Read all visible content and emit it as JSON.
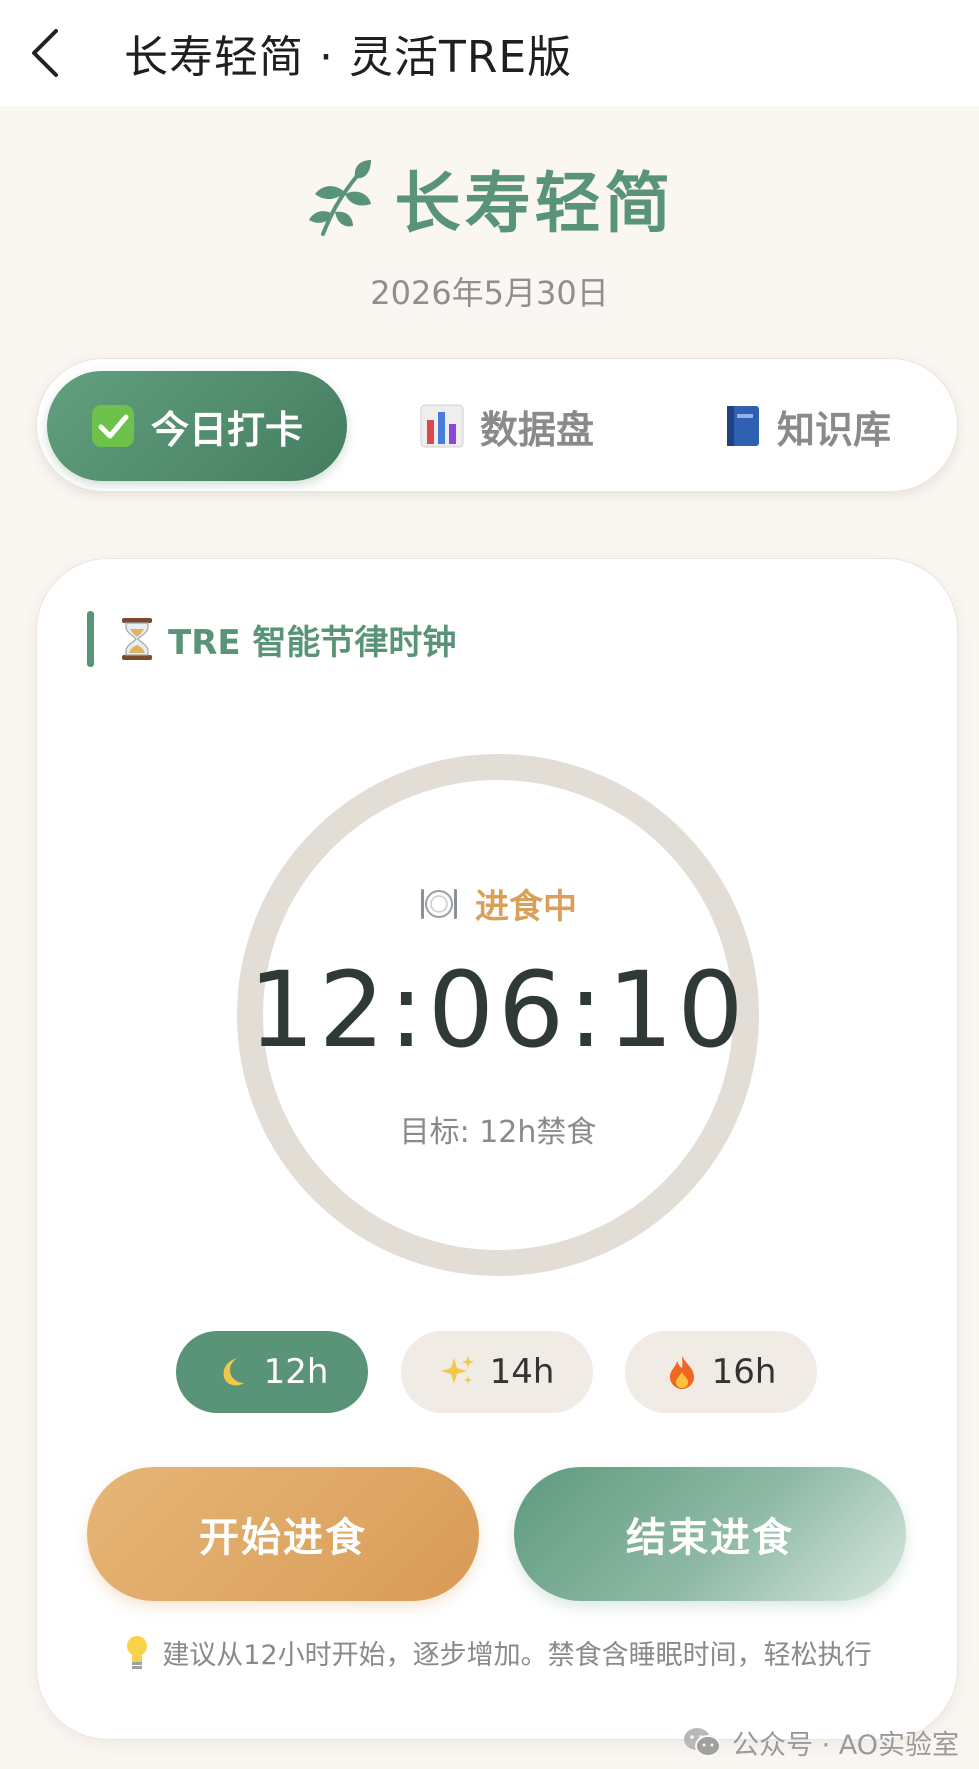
{
  "navbar": {
    "back_icon": "chevron-left-icon",
    "title": "长寿轻简 · 灵活TRE版"
  },
  "brand": {
    "icon": "leaf-sprig-icon",
    "title": "长寿轻简",
    "date": "2026年5月30日",
    "accent_color": "#5a9478"
  },
  "tabs": [
    {
      "label": "今日打卡",
      "icon": "checkmark-box-icon",
      "active": true
    },
    {
      "label": "数据盘",
      "icon": "bar-chart-icon",
      "active": false
    },
    {
      "label": "知识库",
      "icon": "book-icon",
      "active": false
    }
  ],
  "tracker": {
    "section_title": "TRE 智能节律时钟",
    "section_icon": "hourglass-icon",
    "status_icon": "plate-fork-knife-icon",
    "status": "进食中",
    "status_color": "#d9a05b",
    "timer": "12:06:10",
    "goal": "目标: 12h禁食",
    "durations": [
      {
        "label": "12h",
        "icon": "crescent-moon-icon",
        "active": true
      },
      {
        "label": "14h",
        "icon": "sparkles-icon",
        "active": false
      },
      {
        "label": "16h",
        "icon": "fire-icon",
        "active": false
      }
    ],
    "start_button": "开始进食",
    "end_button": "结束进食",
    "tip_icon": "light-bulb-icon",
    "tip": "建议从12小时开始，逐步增加。禁食含睡眠时间，轻松执行"
  },
  "watermark": {
    "icon": "wechat-icon",
    "text": "公众号 · AO实验室"
  }
}
